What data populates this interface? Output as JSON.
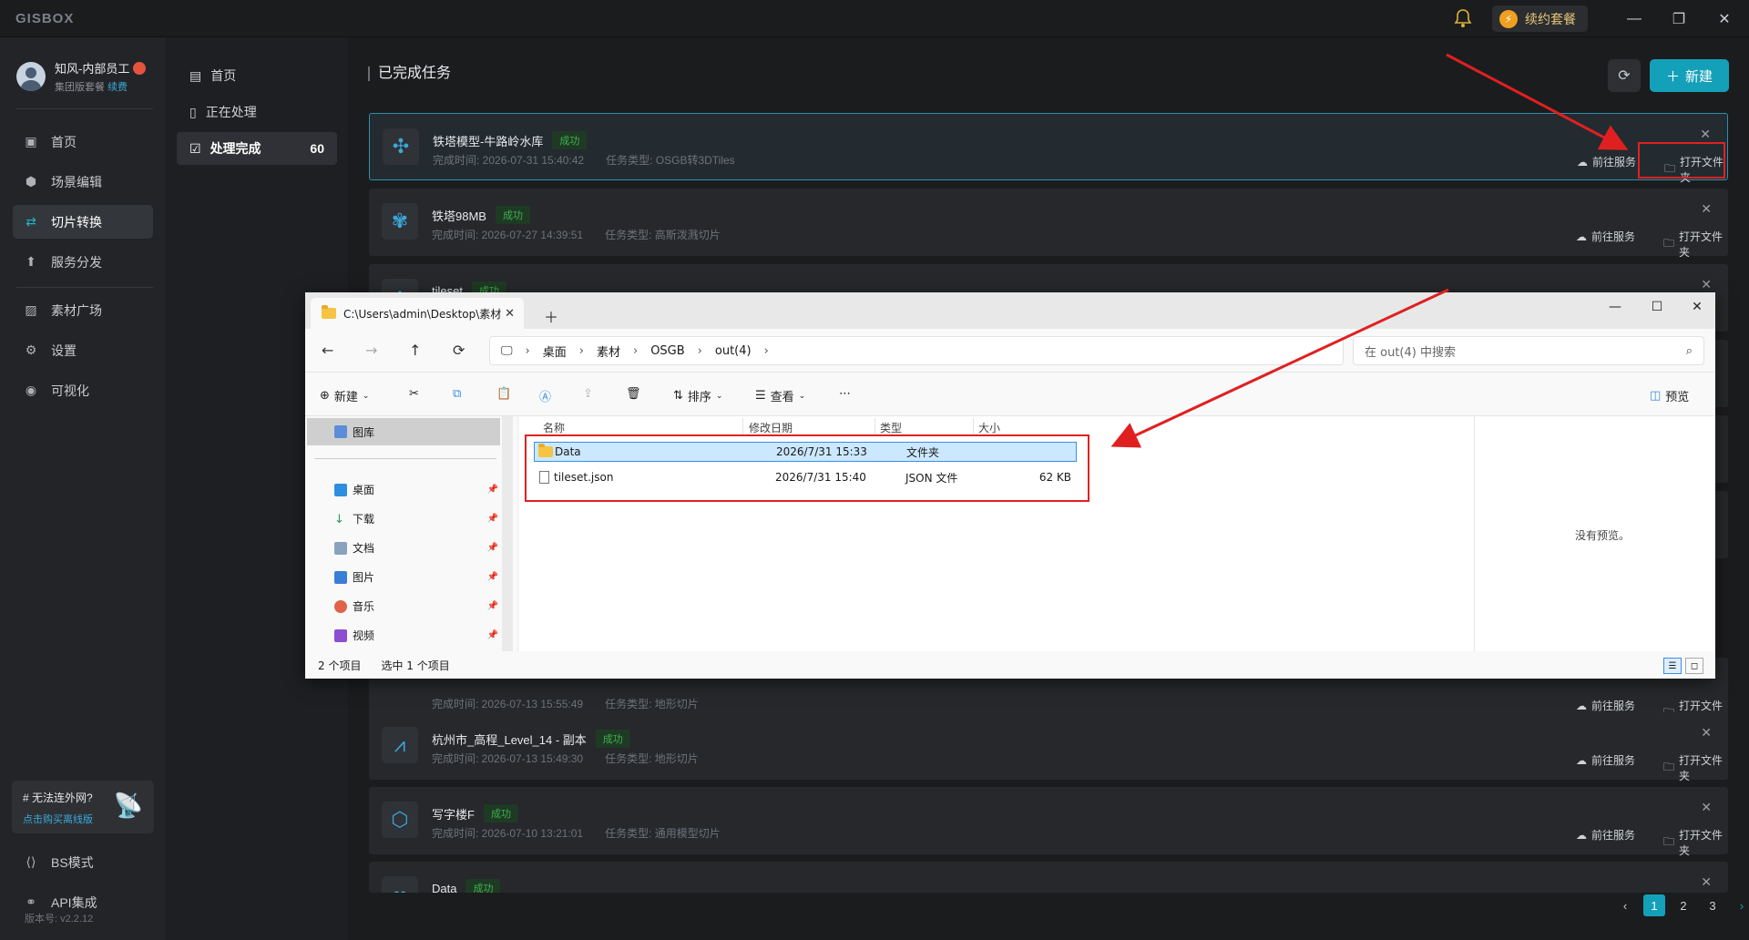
{
  "app": {
    "logo": "GISBOX",
    "renew_label": "续约套餐"
  },
  "user": {
    "name": "知风-内部员工",
    "plan": "集团版套餐",
    "renew_link": "续费"
  },
  "nav": [
    {
      "label": "首页",
      "icon": "home-icon"
    },
    {
      "label": "场景编辑",
      "icon": "cube-icon"
    },
    {
      "label": "切片转换",
      "icon": "swap-icon"
    },
    {
      "label": "服务分发",
      "icon": "upload-icon"
    },
    {
      "label": "素材广场",
      "icon": "image-icon"
    },
    {
      "label": "设置",
      "icon": "gear-icon"
    },
    {
      "label": "可视化",
      "icon": "chart-icon"
    }
  ],
  "promo": {
    "title": "# 无法连外网?",
    "link": "点击购买离线版"
  },
  "bottom_nav": [
    {
      "label": "BS模式"
    },
    {
      "label": "API集成"
    }
  ],
  "version": "版本号: v2.2.12",
  "subnav": [
    {
      "label": "首页"
    },
    {
      "label": "正在处理"
    },
    {
      "label": "处理完成",
      "count": "60"
    }
  ],
  "page": {
    "title": "已完成任务",
    "new_label": "新建"
  },
  "tasks": [
    {
      "name": "铁塔模型-牛路岭水库",
      "status": "成功",
      "time": "完成时间: 2026-07-31 15:40:42",
      "type": "任务类型: OSGB转3DTiles"
    },
    {
      "name": "铁塔98MB",
      "status": "成功",
      "time": "完成时间: 2026-07-27 14:39:51",
      "type": "任务类型: 高斯泼溅切片"
    },
    {
      "name": "tileset",
      "status": "成功",
      "time": "",
      "type": ""
    },
    {
      "name": "",
      "status": "",
      "time": "完成时间: 2026-07-13 15:55:49",
      "type": "任务类型: 地形切片"
    },
    {
      "name": "杭州市_高程_Level_14 - 副本",
      "status": "成功",
      "time": "完成时间: 2026-07-13 15:49:30",
      "type": "任务类型: 地形切片"
    },
    {
      "name": "写字楼F",
      "status": "成功",
      "time": "完成时间: 2026-07-10 13:21:01",
      "type": "任务类型: 通用模型切片"
    },
    {
      "name": "Data",
      "status": "成功",
      "time": "",
      "type": ""
    }
  ],
  "task_actions": {
    "service": "前往服务",
    "folder": "打开文件夹"
  },
  "pager": [
    "1",
    "2",
    "3"
  ],
  "explorer": {
    "tab_title": "C:\\Users\\admin\\Desktop\\素材",
    "breadcrumb": [
      "桌面",
      "素材",
      "OSGB",
      "out(4)"
    ],
    "search_placeholder": "在 out(4) 中搜索",
    "toolbar": {
      "new": "新建",
      "sort": "排序",
      "view": "查看",
      "preview": "预览"
    },
    "sidebar": {
      "library": "图库",
      "items": [
        "桌面",
        "下载",
        "文档",
        "图片",
        "音乐",
        "视频"
      ]
    },
    "columns": [
      "名称",
      "修改日期",
      "类型",
      "大小"
    ],
    "files": [
      {
        "name": "Data",
        "date": "2026/7/31 15:33",
        "type": "文件夹",
        "size": ""
      },
      {
        "name": "tileset.json",
        "date": "2026/7/31 15:40",
        "type": "JSON 文件",
        "size": "62 KB"
      }
    ],
    "no_preview": "没有预览。",
    "status": {
      "count": "2 个项目",
      "selected": "选中 1 个项目"
    }
  },
  "colors": {
    "accent": "#14a0b8",
    "success": "#3fb04f",
    "annotation": "#e02020"
  }
}
